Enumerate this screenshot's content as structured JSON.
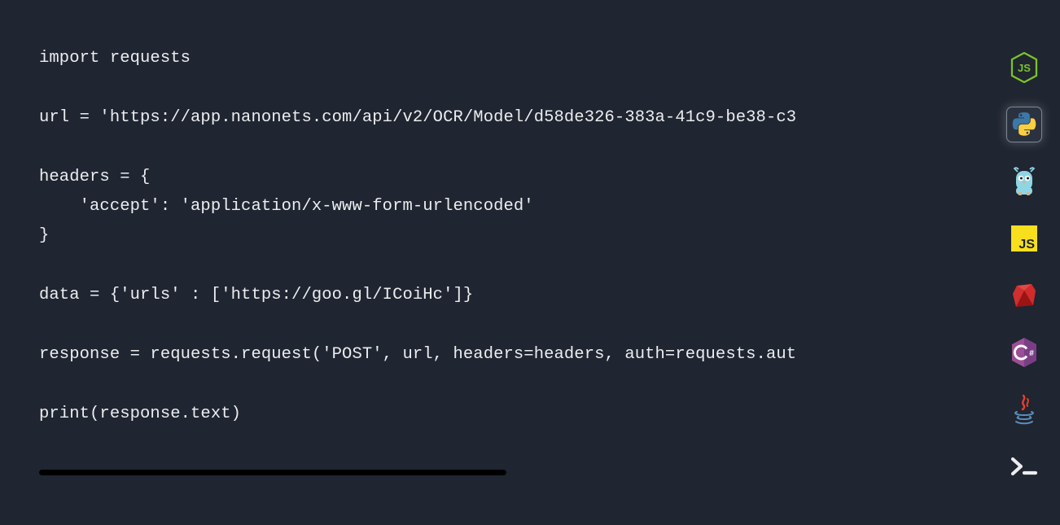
{
  "code": {
    "lines": [
      "import requests",
      "",
      "url = 'https://app.nanonets.com/api/v2/OCR/Model/d58de326-383a-41c9-be38-c3",
      "",
      "headers = {",
      "    'accept': 'application/x-www-form-urlencoded'",
      "}",
      "",
      "data = {'urls' : ['https://goo.gl/ICoiHc']}",
      "",
      "response = requests.request('POST', url, headers=headers, auth=requests.aut",
      "",
      "print(response.text)"
    ]
  },
  "languages": [
    {
      "id": "nodejs",
      "name": "nodejs-icon",
      "active": false
    },
    {
      "id": "python",
      "name": "python-icon",
      "active": true
    },
    {
      "id": "go",
      "name": "golang-icon",
      "active": false
    },
    {
      "id": "js",
      "name": "javascript-icon",
      "active": false
    },
    {
      "id": "ruby",
      "name": "ruby-icon",
      "active": false
    },
    {
      "id": "csharp",
      "name": "csharp-icon",
      "active": false
    },
    {
      "id": "java",
      "name": "java-icon",
      "active": false
    },
    {
      "id": "shell",
      "name": "shell-icon",
      "active": false
    }
  ],
  "colors": {
    "background": "#1f2531",
    "text": "#ecedef"
  }
}
